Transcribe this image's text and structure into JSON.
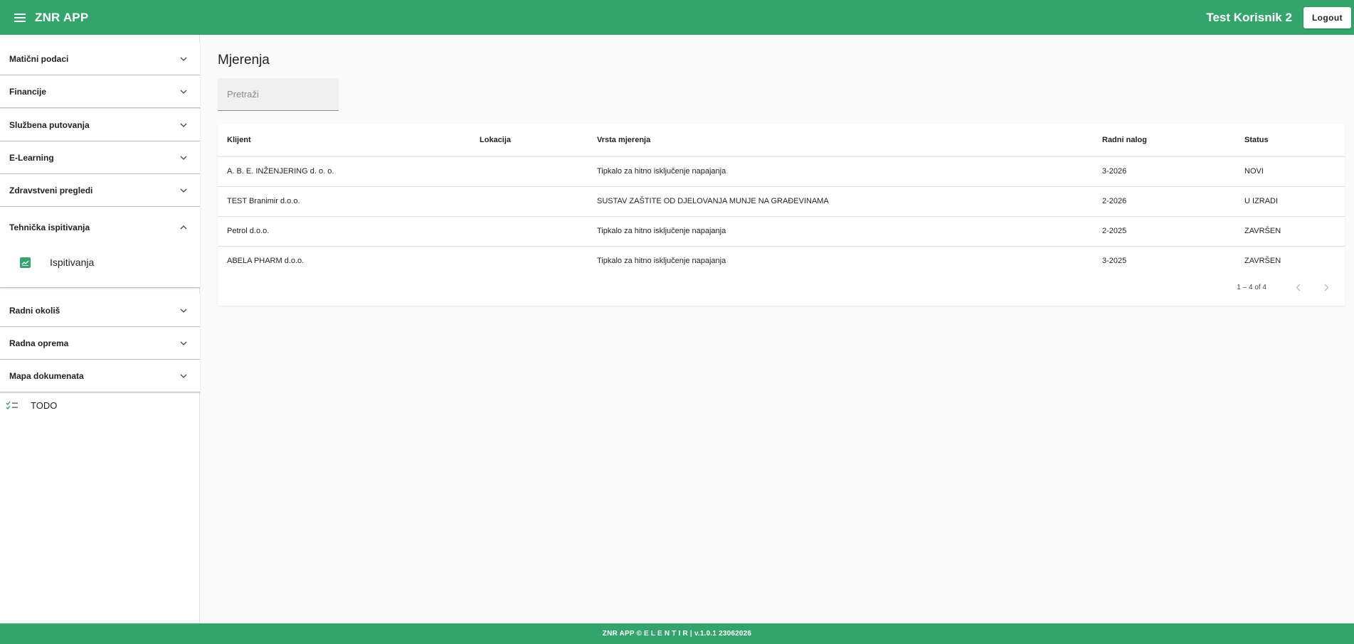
{
  "header": {
    "app_title": "ZNR APP",
    "user_name": "Test Korisnik 2",
    "logout_label": "Logout",
    "menu_icon": "hamburger-icon"
  },
  "sidebar": {
    "items": [
      {
        "label": "Matični podaci",
        "expanded": false
      },
      {
        "label": "Financije",
        "expanded": false
      },
      {
        "label": "Službena putovanja",
        "expanded": false
      },
      {
        "label": "E-Learning",
        "expanded": false
      },
      {
        "label": "Zdravstveni pregledi",
        "expanded": false
      },
      {
        "label": "Tehnička ispitivanja",
        "expanded": true,
        "children": [
          {
            "label": "Ispitivanja",
            "icon": "chart-line-icon"
          }
        ]
      },
      {
        "label": "Radni okoliš",
        "expanded": false
      },
      {
        "label": "Radna oprema",
        "expanded": false
      },
      {
        "label": "Mapa dokumenata",
        "expanded": false
      }
    ],
    "todo": {
      "label": "TODO",
      "icon": "checklist-icon"
    }
  },
  "main": {
    "title": "Mjerenja",
    "search_placeholder": "Pretraži",
    "table": {
      "columns": [
        "Klijent",
        "Lokacija",
        "Vrsta mjerenja",
        "Radni nalog",
        "Status"
      ],
      "rows": [
        [
          "A. B. E. INŽENJERING d. o. o.",
          "",
          "Tipkalo za hitno isključenje napajanja",
          "3-2026",
          "NOVI"
        ],
        [
          "TEST Branimir d.o.o.",
          "",
          "SUSTAV ZAŠTITE OD DJELOVANJA MUNJE NA GRAĐEVINAMA",
          "2-2026",
          "U IZRADI"
        ],
        [
          "Petrol d.o.o.",
          "",
          "Tipkalo za hitno isključenje napajanja",
          "2-2025",
          "ZAVRŠEN"
        ],
        [
          "ABELA PHARM d.o.o.",
          "",
          "Tipkalo za hitno isključenje napajanja",
          "3-2025",
          "ZAVRŠEN"
        ]
      ]
    },
    "paginator": {
      "range": "1 – 4 of 4"
    }
  },
  "footer": {
    "text": "ZNR APP © E L E N T I R | v.1.0.1 23062026"
  },
  "colors": {
    "primary": "#33a56c",
    "background": "#fafafa"
  }
}
